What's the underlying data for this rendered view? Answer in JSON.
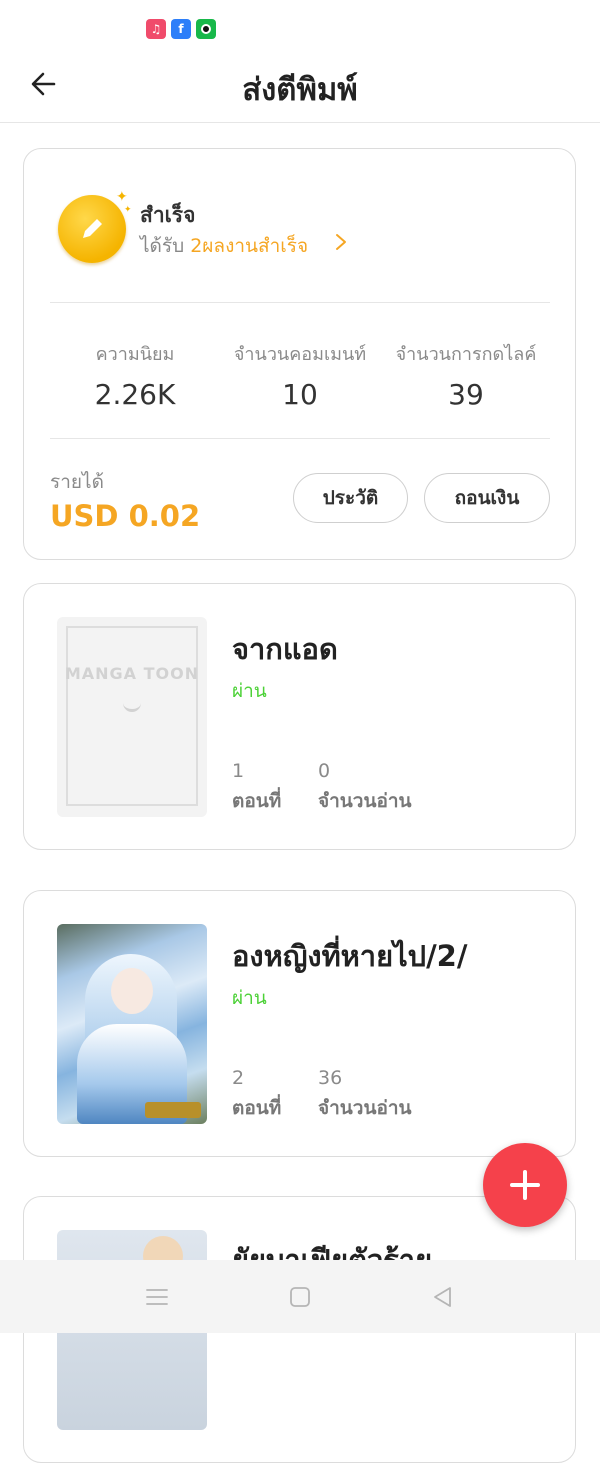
{
  "status_bar": {
    "icons": [
      "music-app-icon",
      "facebook-app-icon",
      "spotify-app-icon"
    ],
    "facebook_glyph": "f"
  },
  "header": {
    "title": "ส่งตีพิมพ์"
  },
  "achievement": {
    "title": "สำเร็จ",
    "subtitle_prefix": "ได้รับ ",
    "subtitle_highlight": "2ผลงานสำเร็จ"
  },
  "stats": [
    {
      "label": "ความนิยม",
      "value": "2.26K"
    },
    {
      "label": "จำนวนคอมเมนท์",
      "value": "10"
    },
    {
      "label": "จำนวนการกดไลค์",
      "value": "39"
    }
  ],
  "income": {
    "label": "รายได้",
    "value": "USD 0.02",
    "history_button": "ประวัติ",
    "withdraw_button": "ถอนเงิน"
  },
  "works": [
    {
      "title": "จากแอด",
      "status": "ผ่าน",
      "episodes": "1",
      "episodes_label": "ตอนที่",
      "reads": "0",
      "reads_label": "จำนวนอ่าน",
      "cover_logo": "MANGA TOON"
    },
    {
      "title": "องหญิงที่หายไป/2/",
      "status": "ผ่าน",
      "episodes": "2",
      "episodes_label": "ตอนที่",
      "reads": "36",
      "reads_label": "จำนวนอ่าน"
    },
    {
      "title": "ยัยบาเฟียตัวร้าย"
    }
  ],
  "colors": {
    "accent_orange": "#f5a623",
    "status_green": "#4cd137",
    "fab_red": "#f5414b"
  }
}
